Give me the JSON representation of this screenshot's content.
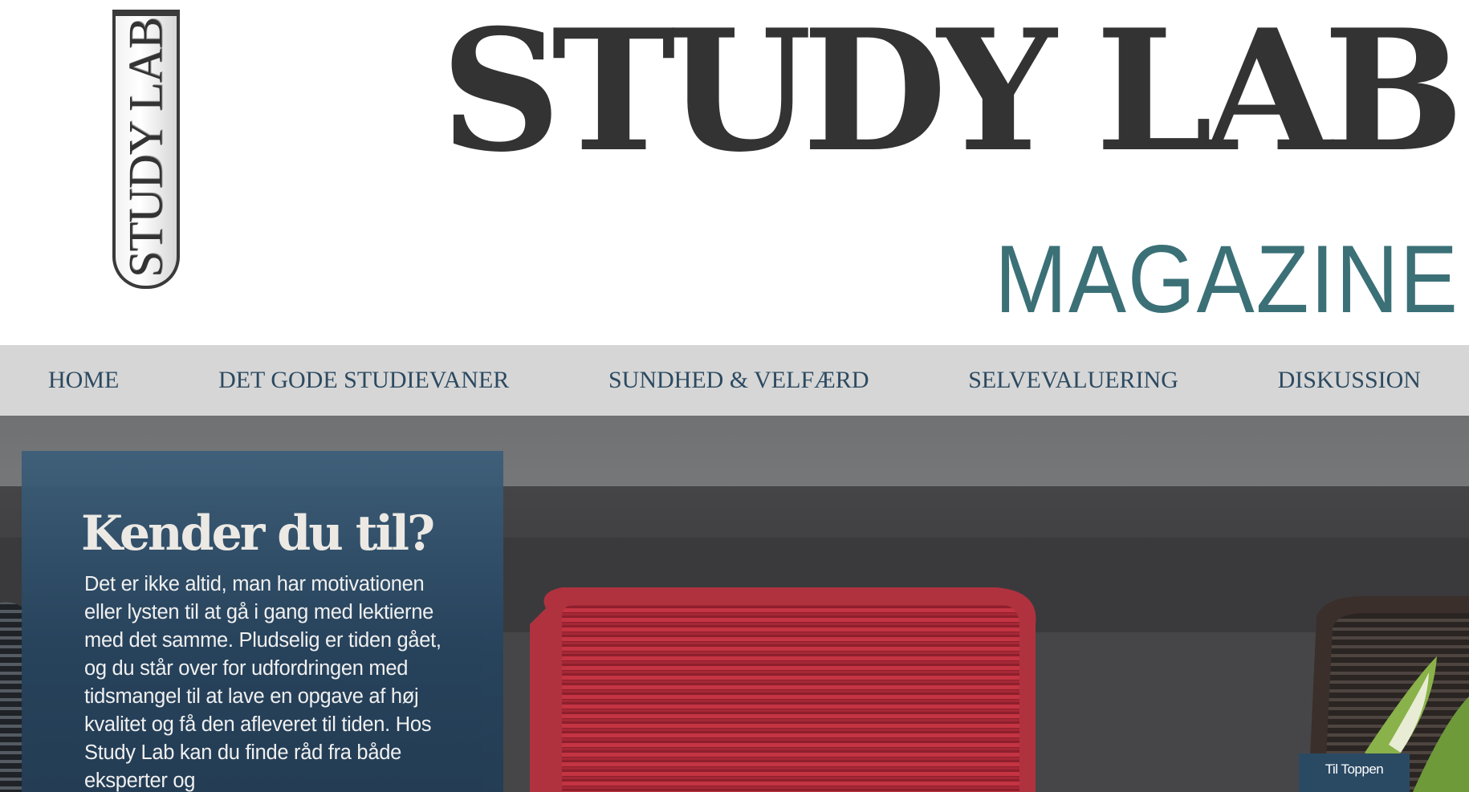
{
  "header": {
    "logo_text": "STUDY LAB",
    "title": "STUDY LAB",
    "subtitle": "MAGAZINE"
  },
  "nav": {
    "items": [
      {
        "label": "HOME"
      },
      {
        "label": "DET GODE STUDIEVANER"
      },
      {
        "label": "SUNDHED & VELFÆRD"
      },
      {
        "label": "SELVEVALUERING"
      },
      {
        "label": "DISKUSSION"
      }
    ]
  },
  "hero": {
    "card": {
      "title": "Kender du til?",
      "text": "Det er ikke altid, man har motivationen eller lysten til at gå i gang med lektierne med det samme. Pludselig er tiden gået, og du står over for udfordringen med tidsmangel til at lave en opgave af høj kvalitet og få den afleveret til tiden. Hos Study Lab kan du finde råd fra både eksperter og"
    },
    "back_to_top_label": "Til Toppen"
  },
  "colors": {
    "brand_dark": "#333333",
    "brand_teal": "#3b7077",
    "nav_background": "#d6d6d6",
    "nav_text": "#2c4a61",
    "card_background": "#2b4a66",
    "chair_red": "#b0323f"
  }
}
